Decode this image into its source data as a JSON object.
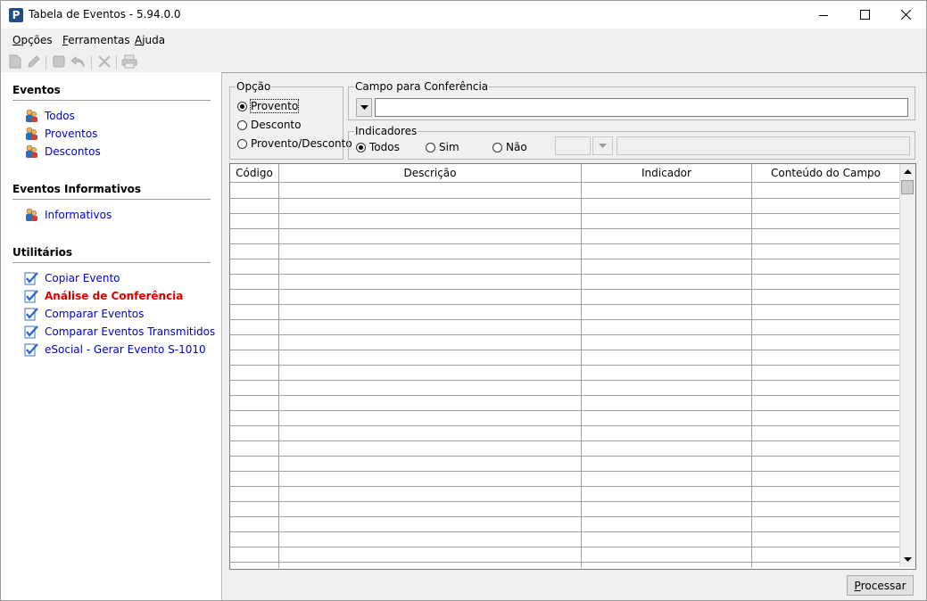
{
  "window": {
    "title": "Tabela de Eventos - 5.94.0.0",
    "app_icon_letter": "P"
  },
  "menu": {
    "items": [
      {
        "label": "Opções",
        "accel": "O",
        "rest": "pções"
      },
      {
        "label": "Ferramentas",
        "accel": "F",
        "rest": "erramentas"
      },
      {
        "label": "Ajuda",
        "accel": "A",
        "rest": "juda"
      }
    ]
  },
  "toolbar": {
    "buttons": [
      "new-icon",
      "edit-icon",
      "stop-icon",
      "undo-icon",
      "delete-icon",
      "print-icon"
    ]
  },
  "sidebar": {
    "sections": [
      {
        "title": "Eventos",
        "items": [
          {
            "label": "Todos",
            "icon": "people-icon"
          },
          {
            "label": "Proventos",
            "icon": "people-icon"
          },
          {
            "label": "Descontos",
            "icon": "people-icon"
          }
        ]
      },
      {
        "title": "Eventos Informativos",
        "items": [
          {
            "label": "Informativos",
            "icon": "people-icon"
          }
        ]
      },
      {
        "title": "Utilitários",
        "items": [
          {
            "label": "Copiar Evento",
            "icon": "checklist-icon"
          },
          {
            "label": "Análise de Conferência",
            "icon": "checklist-icon",
            "active": true
          },
          {
            "label": "Comparar Eventos",
            "icon": "checklist-icon"
          },
          {
            "label": "Comparar Eventos Transmitidos",
            "icon": "checklist-icon"
          },
          {
            "label": "eSocial - Gerar Evento S-1010",
            "icon": "checklist-icon"
          }
        ]
      }
    ]
  },
  "opcao": {
    "legend": "Opção",
    "options": [
      "Provento",
      "Desconto",
      "Provento/Desconto"
    ],
    "selected": "Provento"
  },
  "campo": {
    "legend": "Campo para Conferência",
    "value": ""
  },
  "indicadores": {
    "legend": "Indicadores",
    "options": [
      "Todos",
      "Sim",
      "Não"
    ],
    "selected": "Todos",
    "value": ""
  },
  "grid": {
    "columns": [
      "Código",
      "Descrição",
      "Indicador",
      "Conteúdo do Campo"
    ],
    "rows": []
  },
  "actions": {
    "process_label": "Processar",
    "process_accel": "P",
    "process_rest": "rocessar"
  },
  "colors": {
    "link": "#0000cc",
    "active_link": "#e00000",
    "app_icon": "#1f4f86"
  }
}
